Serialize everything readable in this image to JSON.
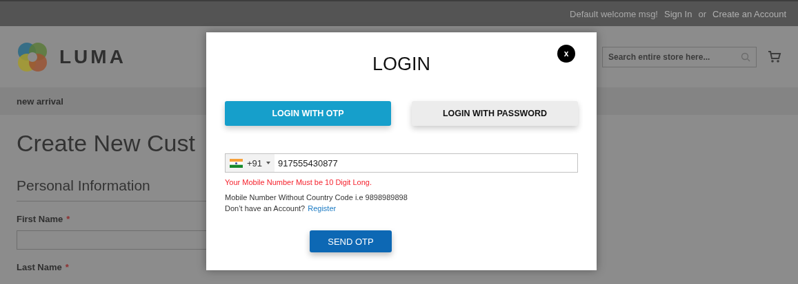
{
  "top_bar": {
    "welcome": "Default welcome msg!",
    "links": [
      {
        "kind": "link",
        "text": "Sign In"
      },
      {
        "kind": "plain",
        "text": "or"
      },
      {
        "kind": "link",
        "text": "Create an Account"
      }
    ]
  },
  "header": {
    "logo_text": "LUMA",
    "search": {
      "placeholder": "Search entire store here..."
    }
  },
  "nav": {
    "items": [
      "new arrival"
    ]
  },
  "page": {
    "title": "Create New Cust",
    "section": "Personal Information",
    "fields": [
      {
        "label": "First Name",
        "required_mark": "*",
        "has_input": true
      },
      {
        "label": "Last Name",
        "required_mark": "*",
        "has_input": false
      }
    ]
  },
  "modal": {
    "title": "LOGIN",
    "close": "x",
    "tabs": [
      {
        "label": "LOGIN WITH OTP",
        "selected": true
      },
      {
        "label": "LOGIN WITH PASSWORD",
        "selected": false
      }
    ],
    "phone": {
      "country_code": "+91",
      "value": "917555430877"
    },
    "error": "Your Mobile Number Must be 10 Digit Long.",
    "hint": "Mobile Number Without Country Code i.e 9898989898",
    "account_prompt": "Don’t have an Account?",
    "register_link": "Register",
    "submit": "SEND OTP"
  }
}
